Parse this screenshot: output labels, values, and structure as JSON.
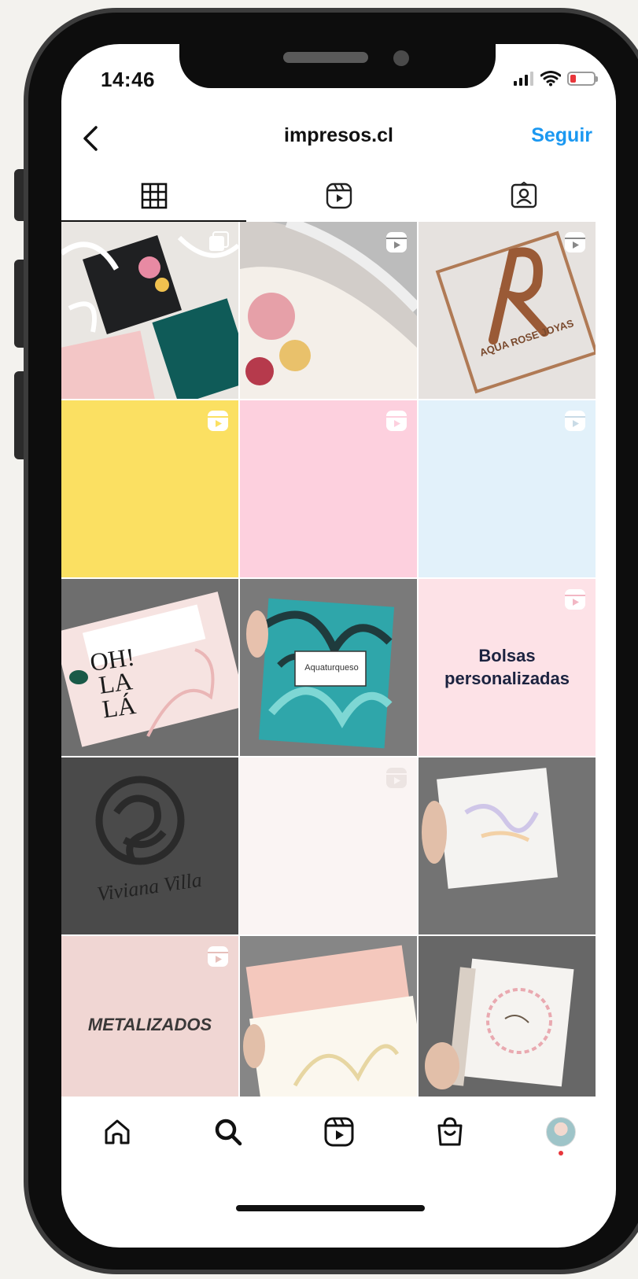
{
  "status_bar": {
    "time": "14:46"
  },
  "header": {
    "title": "impresos.cl",
    "follow_label": "Seguir"
  },
  "tabs": [
    {
      "id": "grid",
      "icon": "grid-icon",
      "active": true
    },
    {
      "id": "reels",
      "icon": "reels-icon",
      "active": false
    },
    {
      "id": "tagged",
      "icon": "tagged-icon",
      "active": false
    }
  ],
  "grid": {
    "tiles": [
      {
        "name": "post-scola-boxes",
        "bg": "#e8e4e0",
        "badge": "carousel"
      },
      {
        "name": "post-ribbon-box",
        "bg": "#cfcac6",
        "badge": "reel"
      },
      {
        "name": "post-aqua-rose-joyas",
        "bg": "#e6e1de",
        "badge": "reel",
        "text": "AQUA ROSE JOYAS"
      },
      {
        "name": "post-yellow",
        "bg": "#fbe062",
        "badge": "reel"
      },
      {
        "name": "post-pink",
        "bg": "#fdd0de",
        "badge": "reel"
      },
      {
        "name": "post-light-blue",
        "bg": "#e2f1fa",
        "badge": "reel"
      },
      {
        "name": "post-giftcard",
        "bg": "#6e6e6e",
        "badge": "",
        "text": "OH! LA LÁ"
      },
      {
        "name": "post-aquaturqueso",
        "bg": "#757575",
        "badge": "",
        "text": "Aquaturqueso"
      },
      {
        "name": "post-bolsas",
        "bg": "#fde2e7",
        "badge": "reel",
        "text": "Bolsas personalizadas"
      },
      {
        "name": "post-viviana-villa",
        "bg": "#4b4b4b",
        "badge": "",
        "text": "Viviana Villa"
      },
      {
        "name": "post-blank",
        "bg": "#faf4f3",
        "badge": "reel"
      },
      {
        "name": "post-holo-card",
        "bg": "#727272",
        "badge": ""
      },
      {
        "name": "post-metalizados",
        "bg": "#f0d6d3",
        "badge": "reel",
        "text": "METALIZADOS"
      },
      {
        "name": "post-giftcard-2",
        "bg": "#858585",
        "badge": ""
      },
      {
        "name": "post-floral-box",
        "bg": "#666666",
        "badge": ""
      }
    ]
  },
  "bottom_nav": [
    {
      "id": "home",
      "icon": "home-icon"
    },
    {
      "id": "search",
      "icon": "search-icon"
    },
    {
      "id": "reels",
      "icon": "reels-icon"
    },
    {
      "id": "shop",
      "icon": "shop-icon"
    },
    {
      "id": "profile",
      "icon": "avatar"
    }
  ],
  "colors": {
    "accent": "#1b98f1",
    "notification": "#e8363b"
  }
}
